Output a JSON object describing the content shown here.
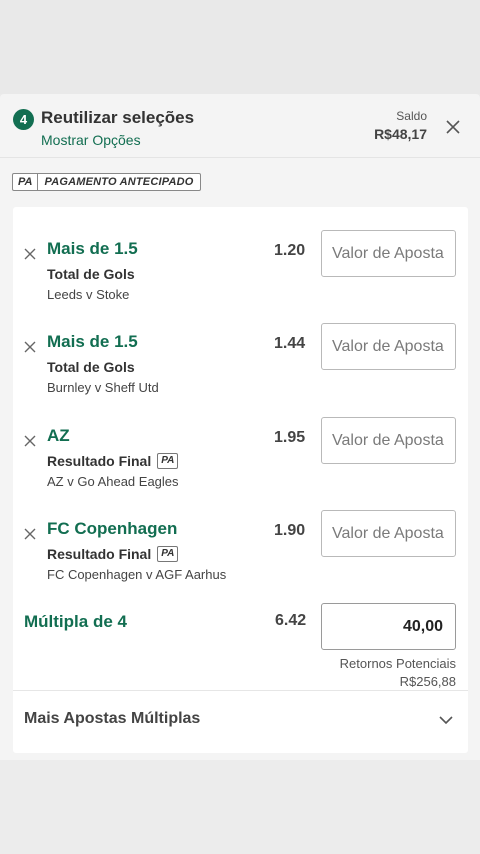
{
  "header": {
    "count": "4",
    "title": "Reutilizar seleções",
    "show_options": "Mostrar Opções",
    "balance_label": "Saldo",
    "balance_value": "R$48,17"
  },
  "pa_banner": {
    "tag": "PA",
    "text": "PAGAMENTO ANTECIPADO"
  },
  "stake_placeholder": "Valor de Aposta",
  "selections": [
    {
      "name": "Mais de 1.5",
      "market": "Total de Gols",
      "pa": "",
      "event": "Leeds v Stoke",
      "odds": "1.20"
    },
    {
      "name": "Mais de 1.5",
      "market": "Total de Gols",
      "pa": "",
      "event": "Burnley v Sheff Utd",
      "odds": "1.44"
    },
    {
      "name": "AZ",
      "market": "Resultado Final",
      "pa": "PA",
      "event": "AZ v Go Ahead Eagles",
      "odds": "1.95"
    },
    {
      "name": "FC Copenhagen",
      "market": "Resultado Final",
      "pa": "PA",
      "event": "FC Copenhagen v AGF Aarhus",
      "odds": "1.90"
    }
  ],
  "multiple": {
    "label": "Múltipla de 4",
    "odds": "6.42",
    "stake": "40,00",
    "returns_label": "Retornos Potenciais",
    "returns_value": "R$256,88"
  },
  "more_bets": {
    "label": "Mais Apostas Múltiplas"
  },
  "colors": {
    "accent": "#126e51",
    "text": "#333333"
  }
}
